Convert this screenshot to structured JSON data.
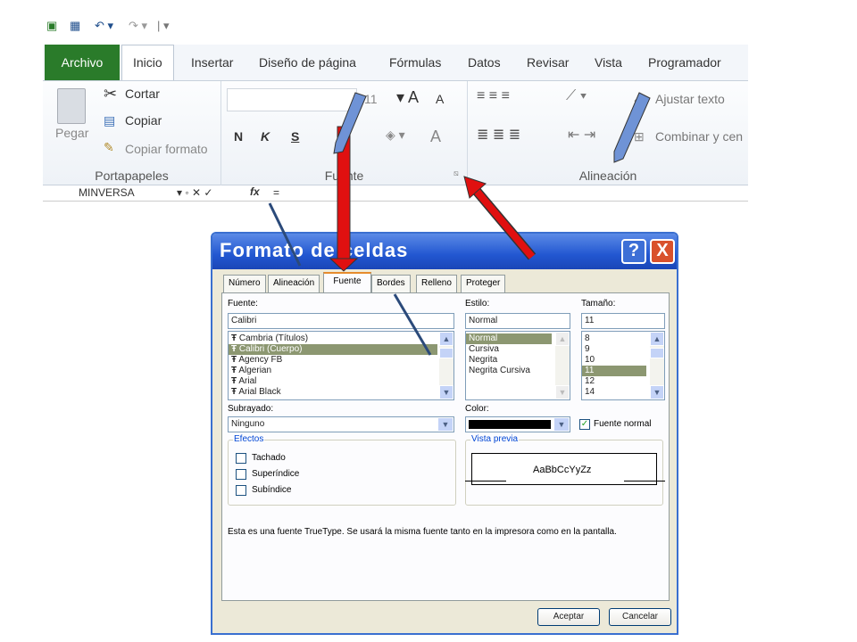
{
  "ribbon": {
    "tabs": [
      "Archivo",
      "Inicio",
      "Insertar",
      "Diseño de página",
      "Fórmulas",
      "Datos",
      "Revisar",
      "Vista",
      "Programador"
    ],
    "clipboard": {
      "paste": "Pegar",
      "cut": "Cortar",
      "copy": "Copiar",
      "format_painter": "Copiar formato",
      "group": "Portapapeles"
    },
    "font_group": {
      "font_size": "11",
      "bold": "N",
      "italic": "K",
      "underline": "S",
      "font_color": "A",
      "group": "Fuente"
    },
    "alignment": {
      "wrap_text": "Ajustar texto",
      "merge": "Combinar y cen",
      "group": "Alineación"
    },
    "formula_bar": {
      "name_box": "MINVERSA",
      "fx": "fx",
      "content": "="
    }
  },
  "dialog": {
    "title": "Formato de celdas",
    "help": "?",
    "close": "X",
    "tabs": [
      "Número",
      "Alineación",
      "Fuente",
      "Bordes",
      "Relleno",
      "Proteger"
    ],
    "active_tab": "Fuente",
    "font_label": "Fuente:",
    "font_value": "Calibri",
    "font_list": [
      "Cambria (Títulos)",
      "Calibri (Cuerpo)",
      "Agency FB",
      "Algerian",
      "Arial",
      "Arial Black"
    ],
    "font_selected_index": 1,
    "style_label": "Estilo:",
    "style_value": "Normal",
    "style_list": [
      "Normal",
      "Cursiva",
      "Negrita",
      "Negrita Cursiva"
    ],
    "size_label": "Tamaño:",
    "size_value": "11",
    "size_list": [
      "8",
      "9",
      "10",
      "11",
      "12",
      "14"
    ],
    "underline_label": "Subrayado:",
    "underline_value": "Ninguno",
    "color_label": "Color:",
    "color_value": "#000000",
    "normal_font_label": "Fuente normal",
    "effects_label": "Efectos",
    "effects": [
      "Tachado",
      "Superíndice",
      "Subíndice"
    ],
    "preview_label": "Vista previa",
    "preview_text": "AaBbCcYyZz",
    "info_text": "Esta es una fuente TrueType. Se usará la misma fuente tanto en la impresora como en la pantalla.",
    "ok": "Aceptar",
    "cancel": "Cancelar"
  },
  "colors": {
    "file_tab": "#2a7b2a",
    "title_bar": "#2257d1",
    "red_arrow": "#e01010",
    "blue_arrow": "#6f93d6"
  }
}
